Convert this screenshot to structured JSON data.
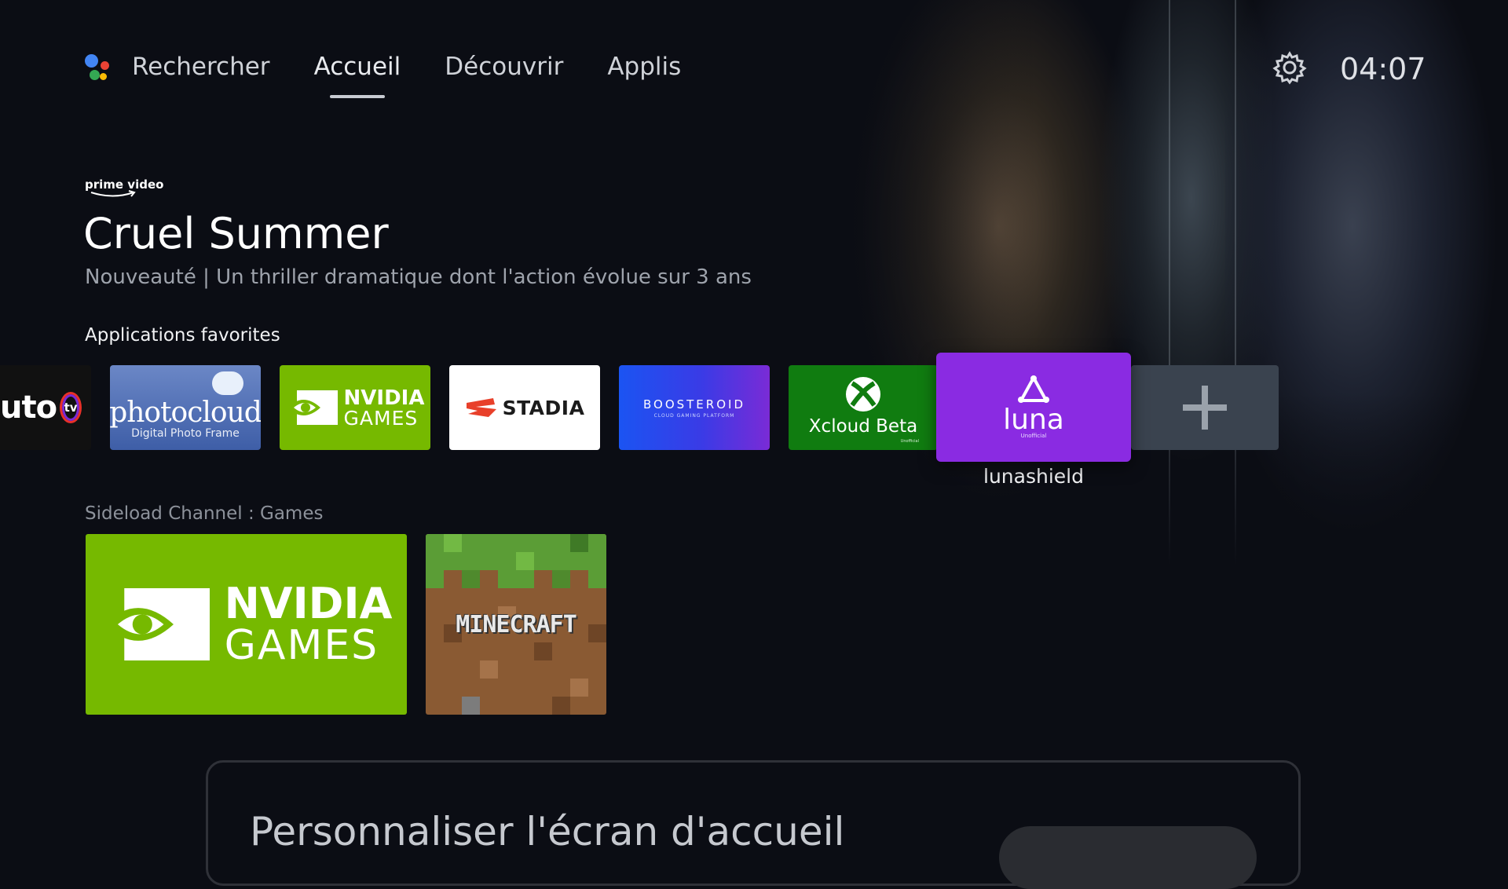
{
  "nav": {
    "items": [
      {
        "label": "Rechercher"
      },
      {
        "label": "Accueil",
        "active": true
      },
      {
        "label": "Découvrir"
      },
      {
        "label": "Applis"
      }
    ],
    "clock": "04:07"
  },
  "hero": {
    "provider": "prime video",
    "title": "Cruel Summer",
    "subtitle": "Nouveauté | Un thriller dramatique dont l'action évolue sur 3 ans"
  },
  "favorites": {
    "title": "Applications favorites",
    "focused_label": "lunashield",
    "tiles": {
      "pluto": "uto",
      "pluto_tv": "tv",
      "photocloud": "photocloud",
      "photocloud_sub": "Digital Photo Frame",
      "nvidia_top": "NVIDIA",
      "nvidia_bottom": "GAMES",
      "stadia": "STADIA",
      "booster": "BOOSTEROID",
      "booster_sub": "CLOUD GAMING PLATFORM",
      "xcloud": "Xcloud Beta",
      "xcloud_sub": "Unofficial",
      "luna": "luna",
      "luna_sub": "Unofficial"
    }
  },
  "sideload": {
    "title": "Sideload Channel : Games",
    "nvidia_top": "NVIDIA",
    "nvidia_bottom": "GAMES",
    "minecraft": "MINECRAFT"
  },
  "customize": {
    "title": "Personnaliser l'écran d'accueil"
  },
  "colors": {
    "background": "#0b0d14",
    "nvidia_green": "#76b900",
    "xbox_green": "#107c10",
    "luna_purple": "#8a2be2",
    "stadia_red": "#e8402a"
  },
  "icons": [
    "google-assistant-icon",
    "gear-icon",
    "plus-icon",
    "xbox-icon",
    "luna-icon",
    "nvidia-eye-icon",
    "stadia-icon"
  ]
}
